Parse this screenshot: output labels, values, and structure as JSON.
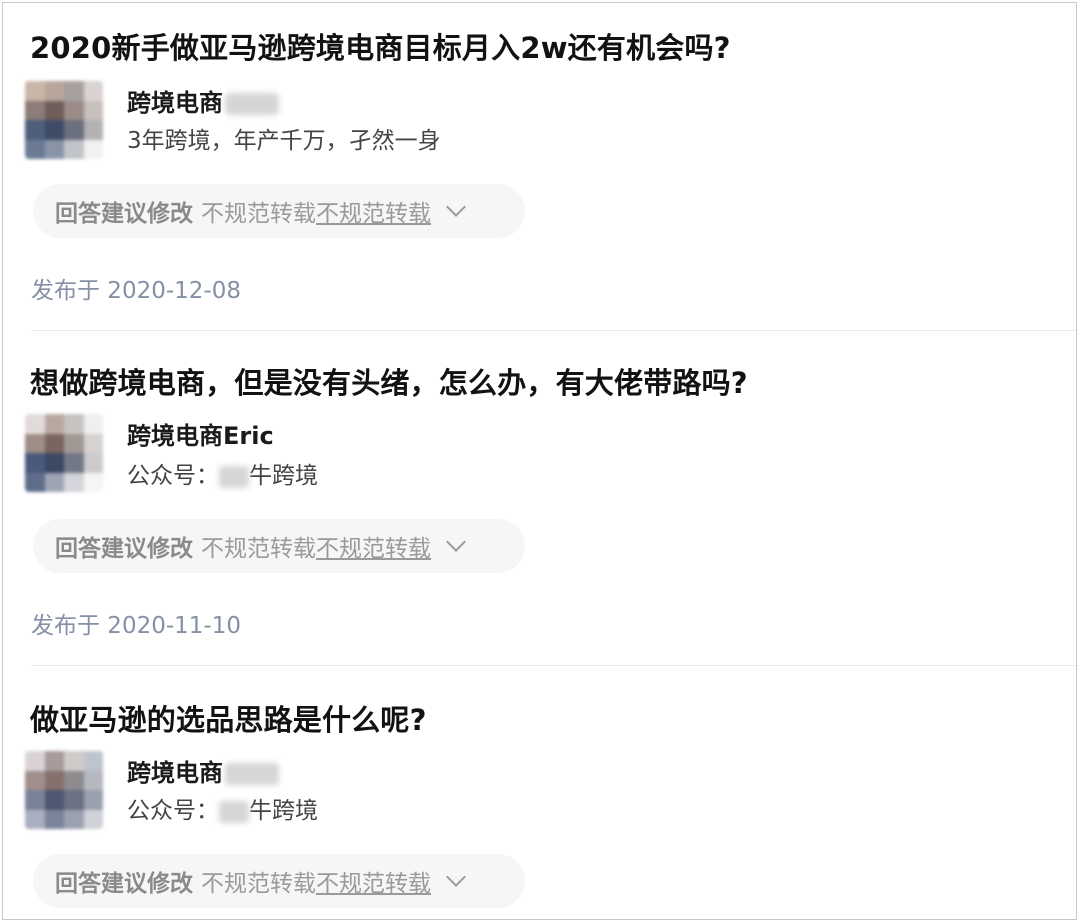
{
  "items": [
    {
      "title": "2020新手做亚马逊跨境电商目标月入2w还有机会吗?",
      "author_name": "跨境电商",
      "author_bio": "3年跨境，年产千万，孑然一身",
      "suggest_label": "回答建议修改",
      "reason_text": "不规范转载",
      "reason_link": "不规范转载",
      "published": "发布于 2020-12-08"
    },
    {
      "title": "想做跨境电商，但是没有头绪，怎么办，有大佬带路吗?",
      "author_name": "跨境电商Eric",
      "author_bio_prefix": "公众号：",
      "author_bio_suffix": "牛跨境",
      "suggest_label": "回答建议修改",
      "reason_text": "不规范转载",
      "reason_link": "不规范转载",
      "published": "发布于 2020-11-10"
    },
    {
      "title": "做亚马逊的选品思路是什么呢?",
      "author_name": "跨境电商",
      "author_bio_prefix": "公众号：",
      "author_bio_suffix": "牛跨境",
      "suggest_label": "回答建议修改",
      "reason_text": "不规范转载",
      "reason_link": "不规范转载"
    }
  ],
  "icons": {
    "expand": "chevron-down-icon"
  },
  "colors": {
    "title": "#121212",
    "date": "#8590a6",
    "pill_bg": "#f6f6f6"
  }
}
